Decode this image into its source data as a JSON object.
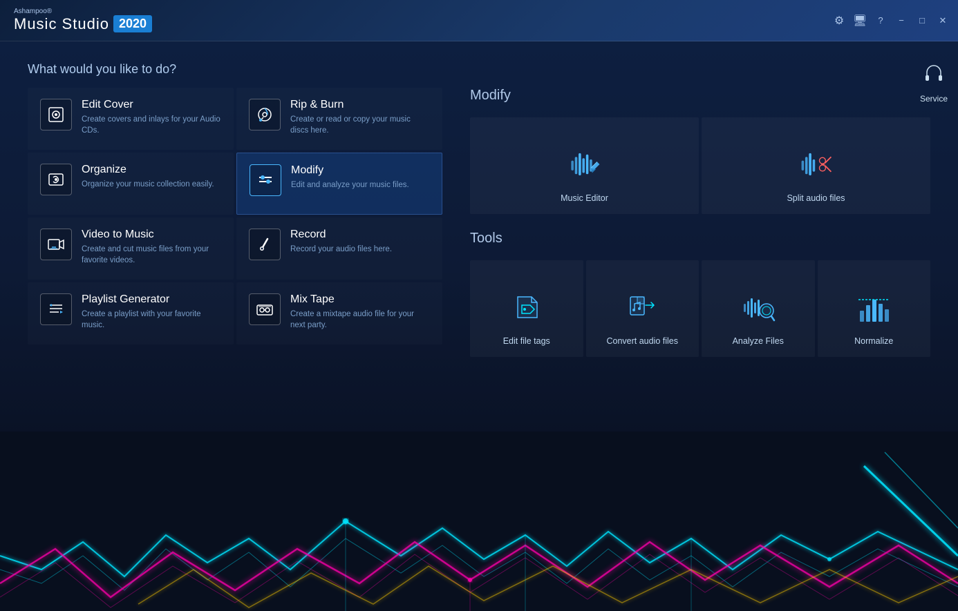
{
  "app": {
    "brand": "Ashampoo®",
    "title": "Music Studio",
    "year": "2020"
  },
  "titlebar": {
    "gear_label": "⚙",
    "monitor_label": "▣",
    "help_label": "?",
    "minimize_label": "−",
    "maximize_label": "□",
    "close_label": "✕"
  },
  "service": {
    "label": "Service",
    "icon": "🎧"
  },
  "main": {
    "heading": "What would you like to do?"
  },
  "left_menu": {
    "items": [
      {
        "id": "edit-cover",
        "title": "Edit Cover",
        "desc": "Create covers and inlays for your Audio CDs.",
        "icon": "📷"
      },
      {
        "id": "rip-burn",
        "title": "Rip & Burn",
        "desc": "Create or read or copy your music discs here.",
        "icon": "💿"
      },
      {
        "id": "organize",
        "title": "Organize",
        "desc": "Organize your music collection easily.",
        "icon": "🎵"
      },
      {
        "id": "modify",
        "title": "Modify",
        "desc": "Edit and analyze your music files.",
        "icon": "⚙",
        "active": true
      },
      {
        "id": "video-to-music",
        "title": "Video to Music",
        "desc": "Create and cut music files from your favorite videos.",
        "icon": "🎬"
      },
      {
        "id": "record",
        "title": "Record",
        "desc": "Record your audio files here.",
        "icon": "🎙"
      },
      {
        "id": "playlist-generator",
        "title": "Playlist Generator",
        "desc": "Create a playlist with your favorite music.",
        "icon": "🎼"
      },
      {
        "id": "mix-tape",
        "title": "Mix Tape",
        "desc": "Create a mixtape audio file for your next party.",
        "icon": "📼"
      }
    ]
  },
  "modify_section": {
    "title": "Modify",
    "tools": [
      {
        "id": "music-editor",
        "label": "Music Editor"
      },
      {
        "id": "split-audio",
        "label": "Split audio files"
      }
    ]
  },
  "tools_section": {
    "title": "Tools",
    "tools": [
      {
        "id": "edit-file-tags",
        "label": "Edit file tags"
      },
      {
        "id": "convert-audio",
        "label": "Convert audio files"
      },
      {
        "id": "analyze-files",
        "label": "Analyze Files"
      },
      {
        "id": "normalize",
        "label": "Normalize"
      }
    ]
  }
}
